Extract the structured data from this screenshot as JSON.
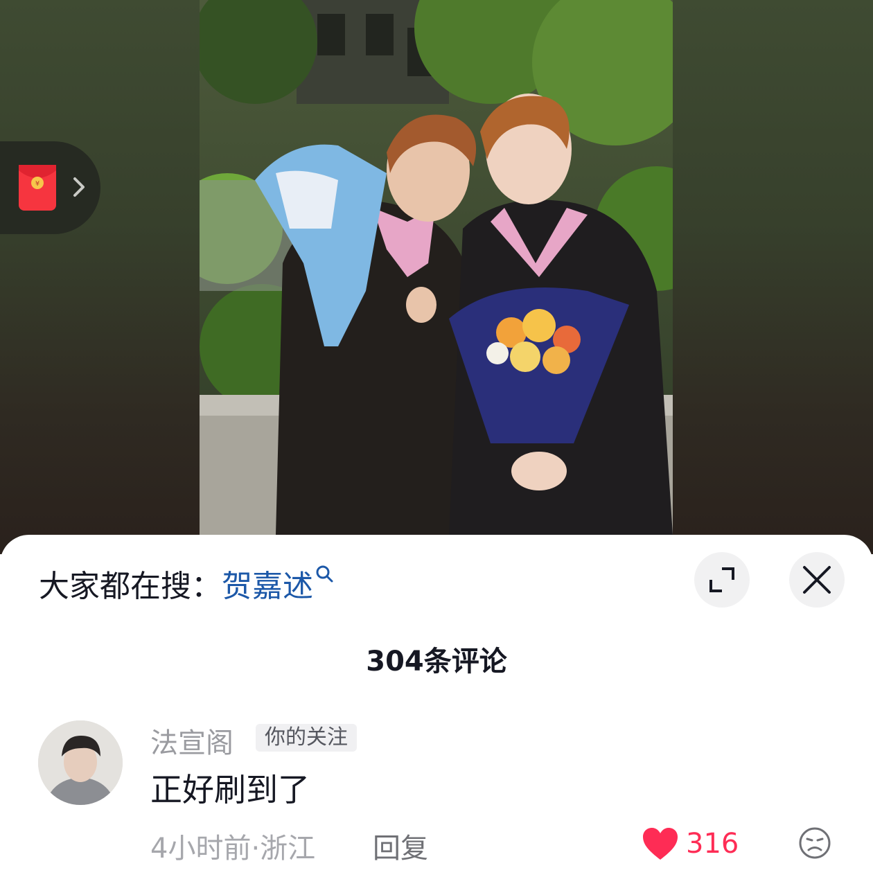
{
  "search_bar": {
    "prefix": "大家都在搜：",
    "term": "贺嘉述"
  },
  "comments_header": {
    "count_label": "304条评论"
  },
  "comment": {
    "username": "法宣阁",
    "badge": "你的关注",
    "text": "正好刷到了",
    "time_location": "4小时前·浙江",
    "reply_label": "回复",
    "like_count": "316"
  },
  "icons": {
    "red_packet": "red-envelope-icon",
    "expand": "expand-icon",
    "close": "close-icon",
    "like": "heart-icon",
    "dislike": "unhappy-face-icon"
  },
  "colors": {
    "accent_link": "#1c58a8",
    "like_red": "#fe2c55",
    "text_primary": "#161823",
    "text_secondary": "#9a9ba0"
  }
}
